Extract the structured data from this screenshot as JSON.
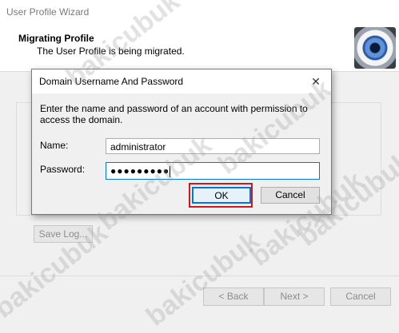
{
  "wizard": {
    "title": "User Profile Wizard",
    "header_title": "Migrating Profile",
    "header_subtitle": "The User Profile is being migrated.",
    "save_log_label": "Save Log...",
    "back_label": "< Back",
    "next_label": "Next >",
    "cancel_label": "Cancel"
  },
  "dialog": {
    "title": "Domain Username And Password",
    "description": "Enter the name and password of an account with permission to access the domain.",
    "name_label": "Name:",
    "name_value": "administrator",
    "password_label": "Password:",
    "password_mask": "●●●●●●●●●",
    "ok_label": "OK",
    "cancel_label": "Cancel",
    "close_glyph": "✕"
  },
  "watermark": "bakicubuk",
  "colors": {
    "highlight": "#d7141a",
    "focus": "#0078d7"
  }
}
